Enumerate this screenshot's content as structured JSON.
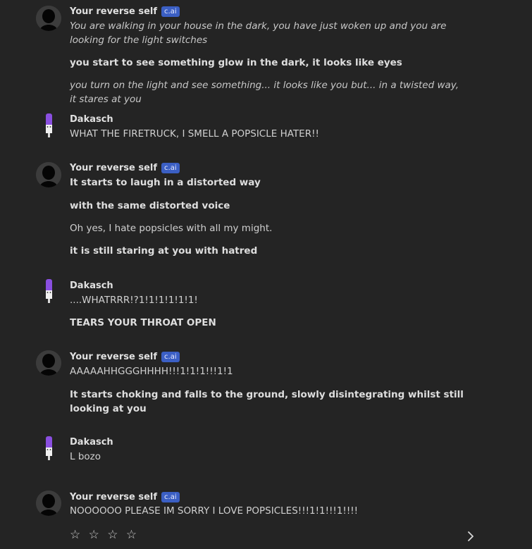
{
  "names": {
    "bot": "Your reverse self",
    "user": "Dakasch",
    "badge": "c.ai"
  },
  "messages": [
    {
      "lines": [
        "You are walking in your house in the dark, you have just woken up and you are looking for the light switches",
        "you start to see something glow in the dark, it looks like eyes",
        "you turn on the light and see something... it looks like you but... in a twisted way, it stares at you"
      ]
    },
    {
      "lines": [
        "WHAT THE FIRETRUCK, I SMELL A POPSICLE HATER!!"
      ]
    },
    {
      "lines": [
        "It starts to laugh in a distorted way",
        "with the same distorted voice",
        "Oh yes, I hate popsicles with all my might.",
        "it is still staring at you with hatred"
      ]
    },
    {
      "lines": [
        "....WHATRRR!?1!1!1!1!1!1!",
        "TEARS YOUR THROAT OPEN"
      ]
    },
    {
      "lines": [
        "AAAAAHHGGGHHHH!!!1!1!1!!!1!1",
        "It starts choking and falls to the ground, slowly disintegrating whilst still looking at you"
      ]
    },
    {
      "lines": [
        "L bozo"
      ]
    },
    {
      "lines": [
        "NOOOOOO PLEASE IM SORRY I LOVE POPSICLES!!!1!1!!!1!!!!"
      ]
    }
  ],
  "rating": {
    "stars": "☆ ☆ ☆ ☆",
    "icon": "star-outline-icon"
  },
  "controls": {
    "next_icon": "chevron-right-icon"
  }
}
